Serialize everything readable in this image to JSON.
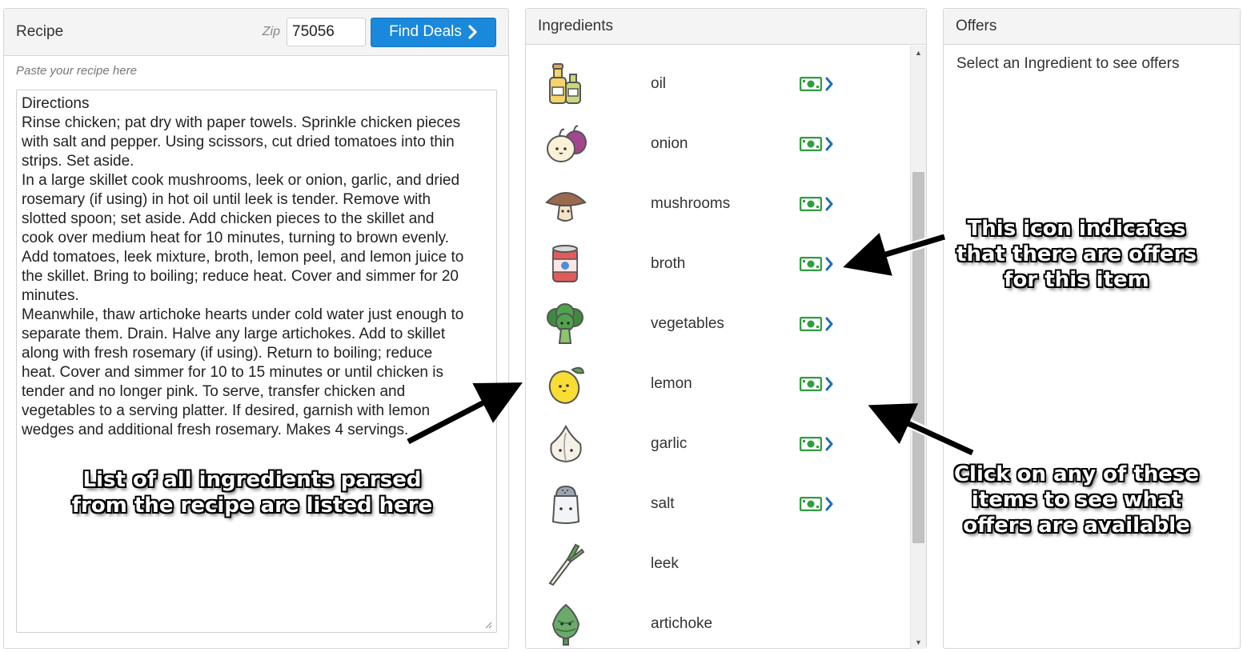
{
  "recipe": {
    "title": "Recipe",
    "zip_label": "Zip",
    "zip_value": "75056",
    "find_button_label": "Find Deals",
    "hint": "Paste your recipe here",
    "text": "Directions\nRinse chicken; pat dry with paper towels. Sprinkle chicken pieces\nwith salt and pepper. Using scissors, cut dried tomatoes into thin\nstrips. Set aside.\nIn a large skillet cook mushrooms, leek or onion, garlic, and dried\nrosemary (if using) in hot oil until leek is tender. Remove with\nslotted spoon; set aside. Add chicken pieces to the skillet and\ncook over medium heat for 10 minutes, turning to brown evenly.\nAdd tomatoes, leek mixture, broth, lemon peel, and lemon juice to\nthe skillet. Bring to boiling; reduce heat. Cover and simmer for 20\nminutes.\nMeanwhile, thaw artichoke hearts under cold water just enough to\nseparate them. Drain. Halve any large artichokes. Add to skillet\nalong with fresh rosemary (if using). Return to boiling; reduce\nheat. Cover and simmer for 10 to 15 minutes or until chicken is\ntender and no longer pink. To serve, transfer chicken and\nvegetables to a serving platter. If desired, garnish with lemon\nwedges and additional fresh rosemary. Makes 4 servings."
  },
  "ingredients": {
    "title": "Ingredients",
    "items": [
      {
        "name": "oil",
        "icon": "oil-bottles-icon",
        "has_offers": true
      },
      {
        "name": "onion",
        "icon": "onion-icon",
        "has_offers": true
      },
      {
        "name": "mushrooms",
        "icon": "mushroom-icon",
        "has_offers": true
      },
      {
        "name": "broth",
        "icon": "broth-can-icon",
        "has_offers": true
      },
      {
        "name": "vegetables",
        "icon": "broccoli-icon",
        "has_offers": true
      },
      {
        "name": "lemon",
        "icon": "lemon-icon",
        "has_offers": true
      },
      {
        "name": "garlic",
        "icon": "garlic-icon",
        "has_offers": true
      },
      {
        "name": "salt",
        "icon": "salt-shaker-icon",
        "has_offers": true
      },
      {
        "name": "leek",
        "icon": "leek-icon",
        "has_offers": false
      },
      {
        "name": "artichoke",
        "icon": "artichoke-icon",
        "has_offers": false
      }
    ]
  },
  "offers": {
    "title": "Offers",
    "empty_message": "Select an Ingredient to see offers"
  },
  "annotations": {
    "offer_icon": [
      "This icon indicates",
      "that there are offers",
      "for this item"
    ],
    "click_items": [
      "Click on any of these",
      "items to see what",
      "offers are available"
    ],
    "ingredient_list": [
      "List of all ingredients parsed",
      "from the recipe are listed here"
    ]
  },
  "colors": {
    "accent_button": "#1a88db",
    "offer_green": "#2e9e3f",
    "chevron_blue": "#1f6fb5"
  }
}
